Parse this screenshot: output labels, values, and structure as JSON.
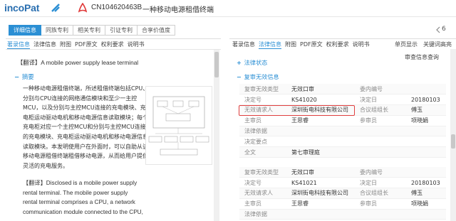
{
  "header": {
    "logo": "incoPat",
    "publication_number": "CN104620463B",
    "title": "一种移动电源租借终端"
  },
  "tabs": [
    "详细信息",
    "同族专利",
    "相关专利",
    "引证专利",
    "合享价值度"
  ],
  "active_tab": 0,
  "page_indicator": "6",
  "left": {
    "subnav": [
      "著录信息",
      "法律信息",
      "附图",
      "PDF原文",
      "权利要求",
      "说明书"
    ],
    "translate_line": "【翻译】A mobile power supply lease terminal",
    "abstract_title": "摘要",
    "abstract_lines": [
      "一种移动电源租借终端，所述租借终端包括CPU、",
      "分别与CPU连接的网络通信模块和至少一主控",
      "MCU，以及分别与主控MCU连接的充电模块、充",
      "电柜运动驱动电机和移动电源信息读取模块；每个",
      "充电柜对应一个主控MCU和分别与主控MCU连接",
      "的充电模块、充电柜运动驱动电机和移动电源信息",
      "读取模块。本发明使用户在外面时，可以自助从该",
      "移动电源租借终端租借移动电源，从而给用户提供",
      "灵活的充电服务。"
    ],
    "translate_en_lines": [
      "【翻译】Disclosed is a mobile power supply",
      "rental terminal. The mobile power supply",
      "rental terminal comprises a CPU, a network",
      "communication module connected to the CPU,"
    ]
  },
  "right": {
    "subnav": [
      "著录信息",
      "法律信息",
      "附图",
      "PDF原文",
      "权利要求",
      "说明书"
    ],
    "top_links": [
      "单页显示",
      "关键词高亮"
    ],
    "review_query": "审查信息查询",
    "sections": {
      "legal_status": "法律状态",
      "invalidation": "复审无效信息"
    },
    "table1": [
      [
        "复审无效类型",
        "无效口审",
        "委内编号",
        ""
      ],
      [
        "决定号",
        "KS41020",
        "决定日",
        "20180103"
      ],
      [
        "无效请求人",
        "深圳街电科技有限公司",
        "合议组组长",
        "傅玉"
      ],
      [
        "主审员",
        "王思睿",
        "参审员",
        "项晓娟"
      ],
      [
        "法律依据",
        "",
        "",
        ""
      ],
      [
        "决定要点",
        "",
        "",
        ""
      ],
      [
        "全文",
        "第七审理庭",
        "",
        ""
      ]
    ],
    "table2": [
      [
        "复审无效类型",
        "无效口审",
        "委内编号",
        ""
      ],
      [
        "决定号",
        "KS41021",
        "决定日",
        "20180103"
      ],
      [
        "无效请求人",
        "深圳街电科技有限公司",
        "合议组组长",
        "傅玉"
      ],
      [
        "主审员",
        "王思睿",
        "参审员",
        "项晓娟"
      ],
      [
        "法律依据",
        "",
        "",
        ""
      ]
    ]
  },
  "colors": {
    "accent": "#2b8fd4",
    "highlight": "#e04040"
  }
}
